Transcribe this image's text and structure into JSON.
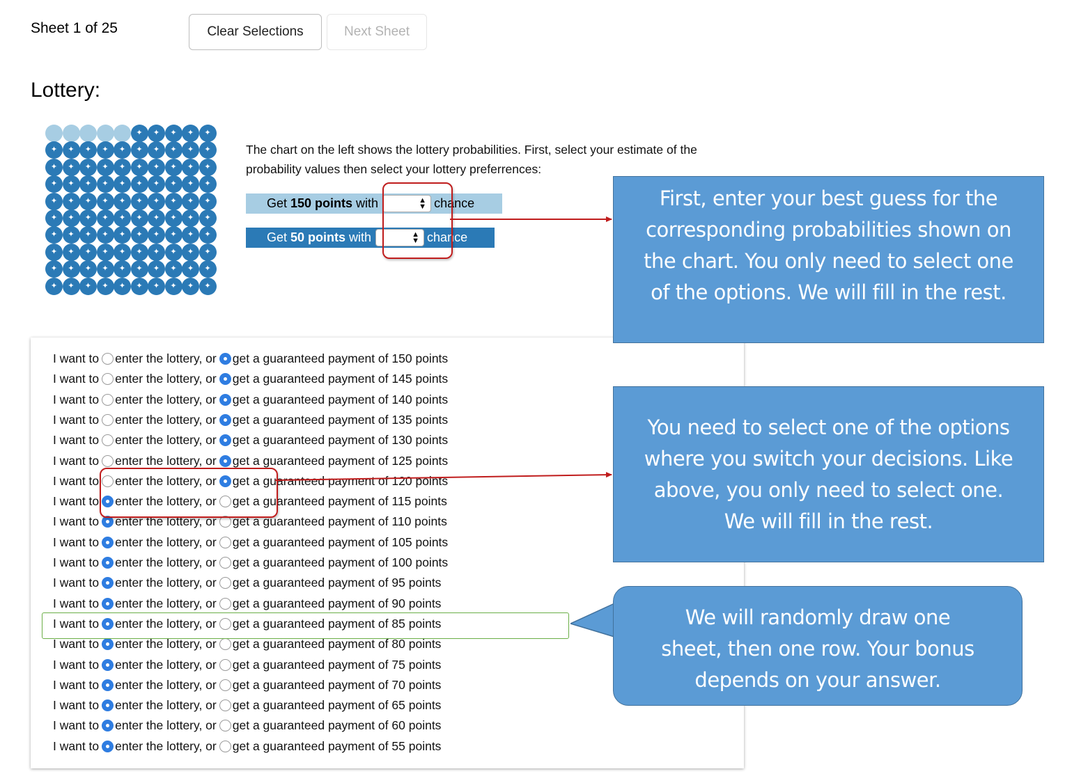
{
  "header": {
    "sheet_label": "Sheet 1 of 25",
    "clear_button": "Clear Selections",
    "next_button": "Next Sheet"
  },
  "title": "Lottery:",
  "dot_chart": {
    "light_dots": 5,
    "total_dots": 100,
    "light_color": "#a7cde3",
    "dark_color": "#2b7ab6"
  },
  "instructions": "The chart on the left shows the lottery probabilities. First, select your estimate of the probability values then select your lottery preferrences:",
  "probability_rows": [
    {
      "prefix": "Get ",
      "points": "150 points",
      "mid": " with",
      "suffix": "chance",
      "selected_value": ""
    },
    {
      "prefix": "Get ",
      "points": "50 points",
      "mid": " with",
      "suffix": "chance",
      "selected_value": ""
    }
  ],
  "choices": {
    "prefix": "I want to",
    "lottery_label": "enter the lottery, or",
    "payment_prefix": "get a guaranteed payment of",
    "rows": [
      {
        "amount": "150 points",
        "choice": "payment"
      },
      {
        "amount": "145 points",
        "choice": "payment"
      },
      {
        "amount": "140 points",
        "choice": "payment"
      },
      {
        "amount": "135 points",
        "choice": "payment"
      },
      {
        "amount": "130 points",
        "choice": "payment"
      },
      {
        "amount": "125 points",
        "choice": "payment"
      },
      {
        "amount": "120 points",
        "choice": "payment"
      },
      {
        "amount": "115 points",
        "choice": "lottery"
      },
      {
        "amount": "110 points",
        "choice": "lottery"
      },
      {
        "amount": "105 points",
        "choice": "lottery"
      },
      {
        "amount": "100 points",
        "choice": "lottery"
      },
      {
        "amount": "95 points",
        "choice": "lottery"
      },
      {
        "amount": "90 points",
        "choice": "lottery"
      },
      {
        "amount": "85 points",
        "choice": "lottery"
      },
      {
        "amount": "80 points",
        "choice": "lottery"
      },
      {
        "amount": "75 points",
        "choice": "lottery"
      },
      {
        "amount": "70 points",
        "choice": "lottery"
      },
      {
        "amount": "65 points",
        "choice": "lottery"
      },
      {
        "amount": "60 points",
        "choice": "lottery"
      },
      {
        "amount": "55 points",
        "choice": "lottery"
      }
    ]
  },
  "callouts": {
    "one": [
      "First, enter your best guess for the",
      "corresponding probabilities shown on",
      "the chart. You only need to select one",
      "of the options. We will fill in the rest."
    ],
    "two": [
      "You need to select one of the options",
      "where you switch your decisions. Like",
      "above, you only need to select one.",
      "We will fill in the rest."
    ],
    "three": [
      "We will randomly draw one",
      "sheet, then one row. Your bonus",
      "depends on your answer."
    ]
  },
  "colors": {
    "callout_fill": "#5b9bd5",
    "highlight_red": "#c01d1d",
    "highlight_green": "#6aae46",
    "radio_selected": "#2f7de1"
  }
}
